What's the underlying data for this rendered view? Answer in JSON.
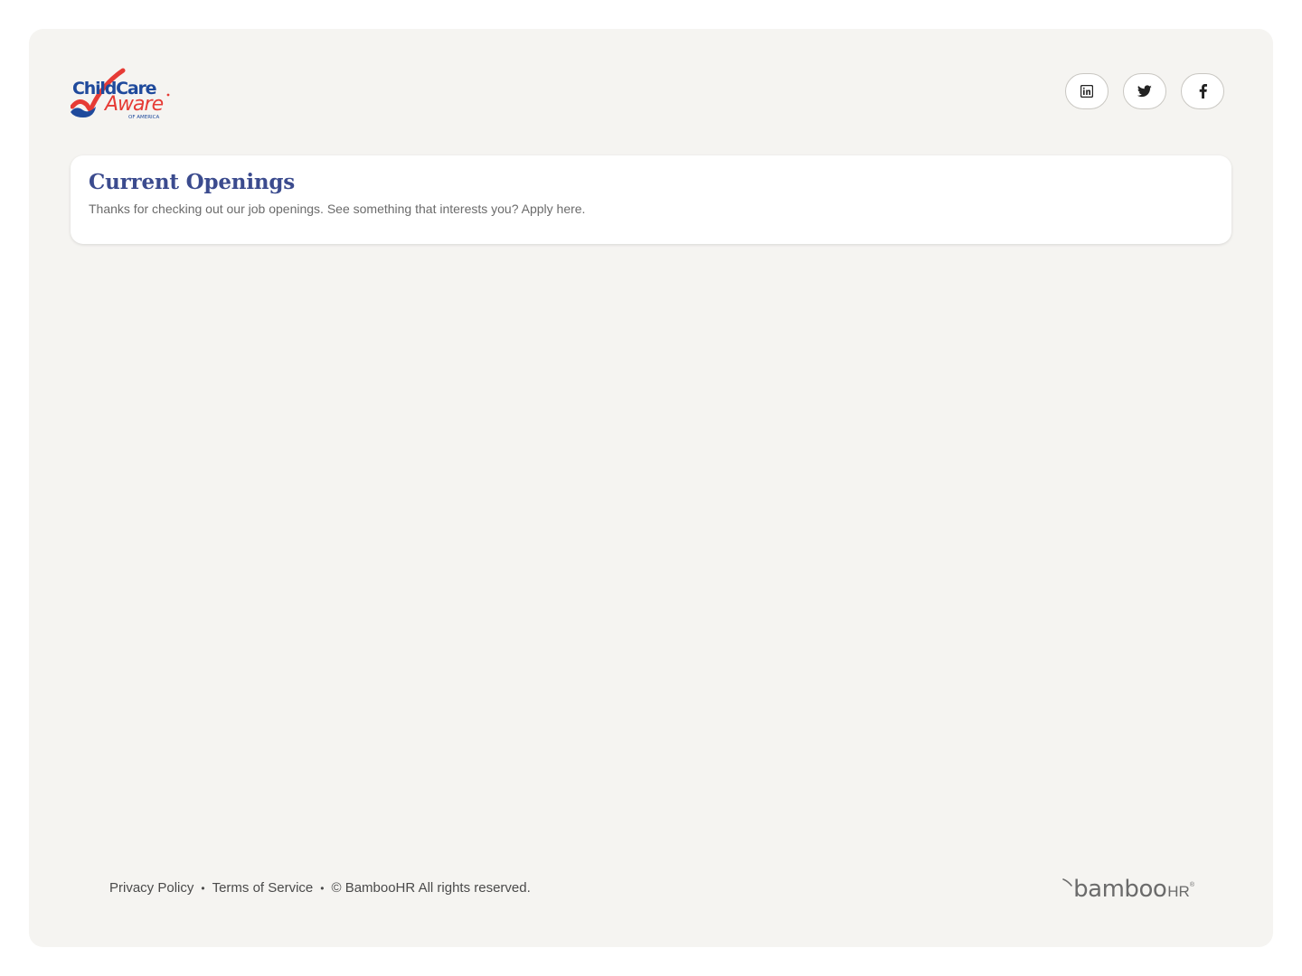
{
  "brand": {
    "logo_alt": "Child Care Aware of America",
    "logo_line1": "ChildCare",
    "logo_line2": "Aware",
    "logo_line3": "OF AMERICA",
    "colors": {
      "blue": "#1f4a9c",
      "red": "#e63b35",
      "title": "#3b4b8e",
      "background": "#f5f4f1"
    }
  },
  "social": [
    {
      "name": "linkedin",
      "icon": "linkedin-icon"
    },
    {
      "name": "twitter",
      "icon": "twitter-icon"
    },
    {
      "name": "facebook",
      "icon": "facebook-icon"
    }
  ],
  "openings": {
    "title": "Current Openings",
    "subtitle": "Thanks for checking out our job openings. See something that interests you? Apply here."
  },
  "footer": {
    "privacy": "Privacy Policy",
    "terms": "Terms of Service",
    "copyright": "© BambooHR All rights reserved.",
    "bamboo_word": "bamboo",
    "bamboo_hr": "HR"
  }
}
